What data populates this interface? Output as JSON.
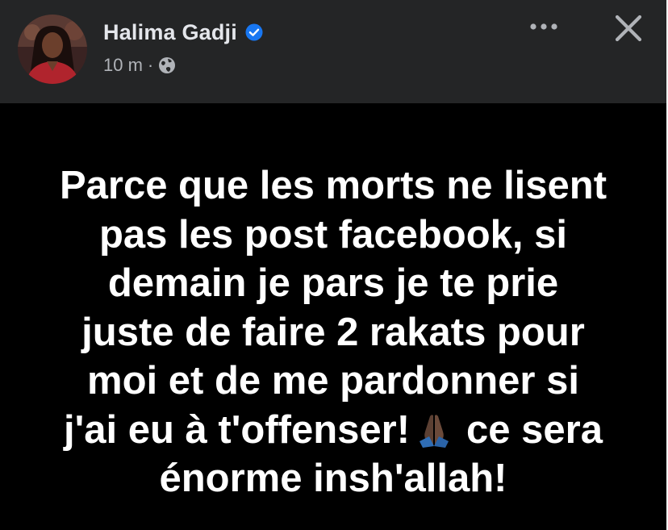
{
  "post": {
    "author": "Halima Gadji",
    "verified": true,
    "time": "10 m",
    "separator": "·",
    "audience_icon": "globe-icon",
    "more_icon": "more-horizontal-icon",
    "close_icon": "close-icon",
    "text_lines": [
      "Parce que les morts ne lisent",
      "pas les post facebook, si",
      "demain je pars je te prie",
      "juste de faire 2 rakats pour",
      "moi et de me pardonner si"
    ],
    "line6_before_emoji": "j'ai eu à t'offenser!",
    "emoji": "folded-hands-emoji",
    "line6_after_emoji": "ce sera",
    "line7": "énorme insh'allah!"
  },
  "colors": {
    "header_bg": "#242526",
    "post_bg": "#000000",
    "text": "#ffffff",
    "name_text": "#e4e6eb",
    "meta_text": "#b0b3b8",
    "verified_badge": "#1877f2"
  }
}
